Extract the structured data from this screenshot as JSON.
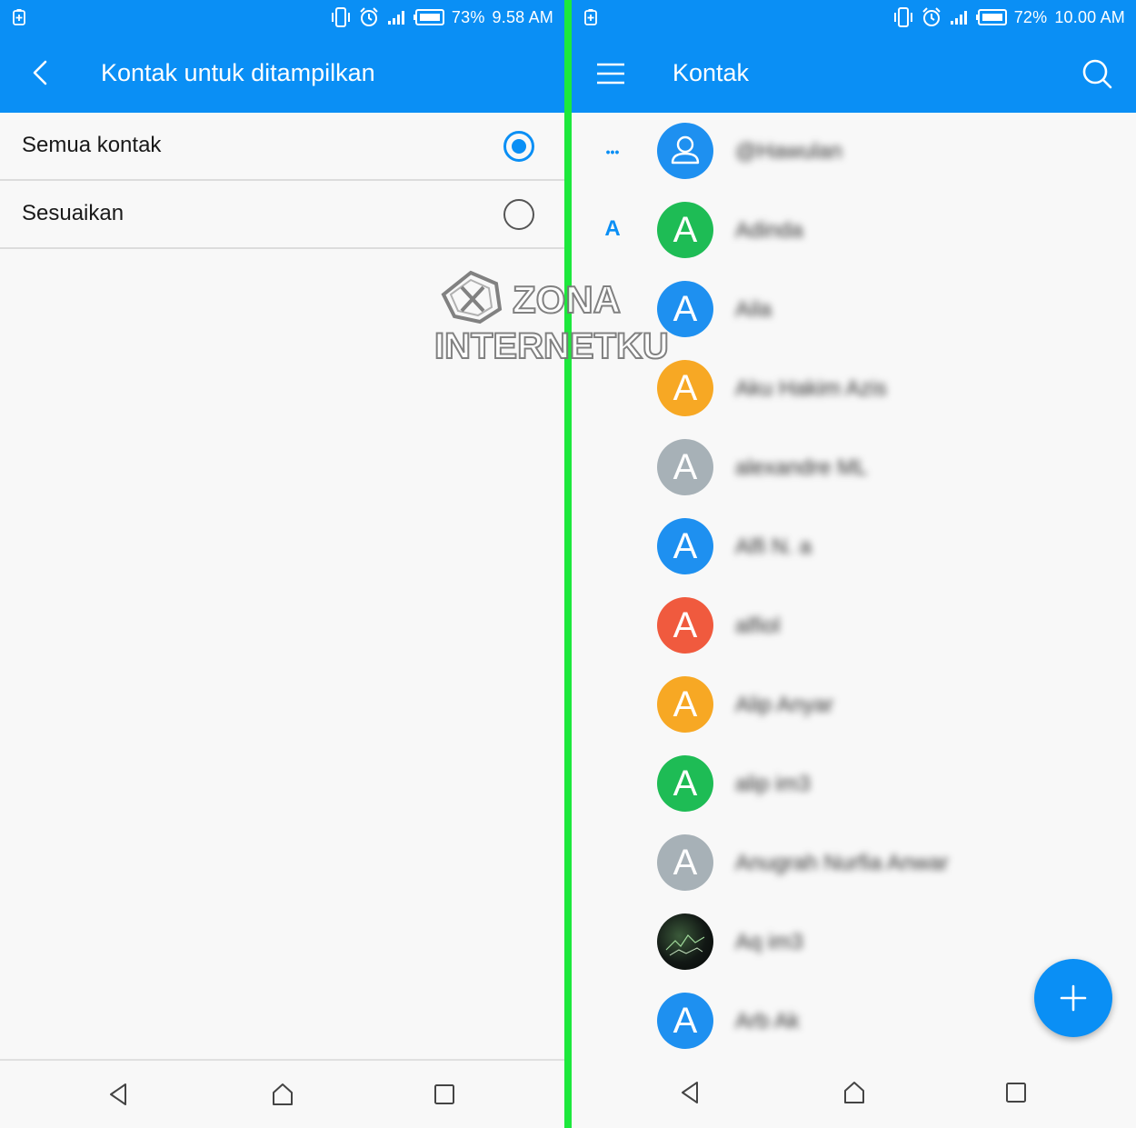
{
  "left": {
    "status": {
      "battery": "73%",
      "time": "9.58 AM"
    },
    "title": "Kontak untuk ditampilkan",
    "options": [
      {
        "label": "Semua kontak",
        "selected": true
      },
      {
        "label": "Sesuaikan",
        "selected": false
      }
    ]
  },
  "right": {
    "status": {
      "battery": "72%",
      "time": "10.00 AM"
    },
    "title": "Kontak",
    "contacts": [
      {
        "section": "•••",
        "initial": "",
        "name": "@Hawulan",
        "color": "#1e90f0",
        "avatar": "person-icon"
      },
      {
        "section": "A",
        "initial": "A",
        "name": "Adinda",
        "color": "#1ebc55"
      },
      {
        "section": "",
        "initial": "A",
        "name": "Aila",
        "color": "#1e90f0"
      },
      {
        "section": "",
        "initial": "A",
        "name": "Aku Hakim Azis",
        "color": "#f7a824"
      },
      {
        "section": "",
        "initial": "A",
        "name": "alexandre ML",
        "color": "#a7b1b7"
      },
      {
        "section": "",
        "initial": "A",
        "name": "Alfi N. a",
        "color": "#1e90f0"
      },
      {
        "section": "",
        "initial": "A",
        "name": "alfiol",
        "color": "#f05a3e"
      },
      {
        "section": "",
        "initial": "A",
        "name": "Alip Anyar",
        "color": "#f7a824"
      },
      {
        "section": "",
        "initial": "A",
        "name": "alip im3",
        "color": "#1ebc55"
      },
      {
        "section": "",
        "initial": "A",
        "name": "Anugrah Nurfia Anwar",
        "color": "#a7b1b7"
      },
      {
        "section": "",
        "initial": "",
        "name": "Aq im3",
        "color": "#1b2220",
        "avatar": "photo"
      },
      {
        "section": "",
        "initial": "A",
        "name": "Arb Ak",
        "color": "#1e90f0"
      }
    ]
  },
  "watermark": {
    "line1": "ZONA",
    "line2": "INTERNETKU"
  },
  "colors": {
    "accent": "#0a8ff5",
    "divider": "#1de83c"
  }
}
